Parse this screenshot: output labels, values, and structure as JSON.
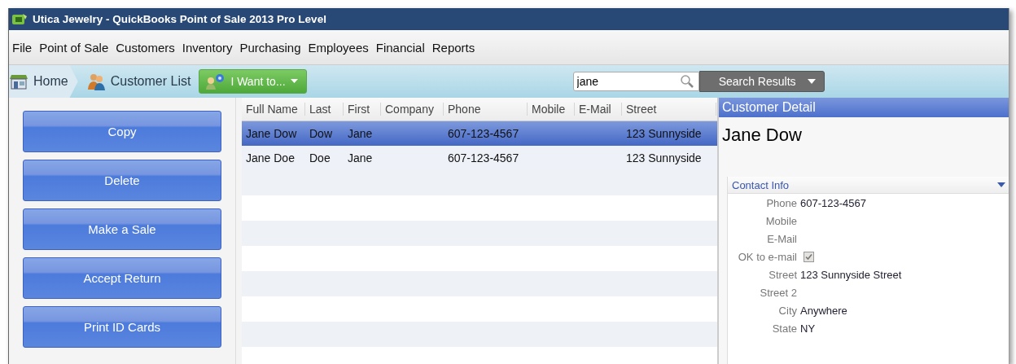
{
  "window": {
    "title": "Utica Jewelry - QuickBooks Point of Sale 2013 Pro Level"
  },
  "menu": [
    "File",
    "Point of Sale",
    "Customers",
    "Inventory",
    "Purchasing",
    "Employees",
    "Financial",
    "Reports"
  ],
  "breadcrumb": [
    "Home",
    "Customer List"
  ],
  "action_menu": {
    "label": "I Want to..."
  },
  "search": {
    "value": "jane"
  },
  "search_scope": {
    "label": "Search Results"
  },
  "side_buttons": [
    "Copy",
    "Delete",
    "Make a Sale",
    "Accept Return",
    "Print ID Cards"
  ],
  "table": {
    "columns": [
      "Full Name",
      "Last",
      "First",
      "Company",
      "Phone",
      "Mobile",
      "E-Mail",
      "Street"
    ],
    "rows": [
      {
        "selected": true,
        "cells": [
          "Jane Dow",
          "Dow",
          "Jane",
          "",
          "607-123-4567",
          "",
          "",
          "123 Sunnyside"
        ]
      },
      {
        "selected": false,
        "cells": [
          "Jane Doe",
          "Doe",
          "Jane",
          "",
          "607-123-4567",
          "",
          "",
          "123 Sunnyside"
        ]
      }
    ]
  },
  "detail": {
    "title": "Customer Detail",
    "name": "Jane Dow",
    "section": {
      "title": "Contact Info",
      "expanded": true
    },
    "fields": [
      {
        "kind": "text",
        "label": "Phone",
        "value": "607-123-4567"
      },
      {
        "kind": "text",
        "label": "Mobile"
      },
      {
        "kind": "text",
        "label": "E-Mail"
      },
      {
        "kind": "checkbox",
        "label": "OK to e-mail",
        "checked": true
      },
      {
        "kind": "text",
        "label": "Street",
        "value": "123 Sunnyside Street"
      },
      {
        "kind": "text",
        "label": "Street 2"
      },
      {
        "kind": "text",
        "label": "City",
        "value": "Anywhere"
      },
      {
        "kind": "text",
        "label": "State",
        "value": "NY"
      }
    ]
  }
}
